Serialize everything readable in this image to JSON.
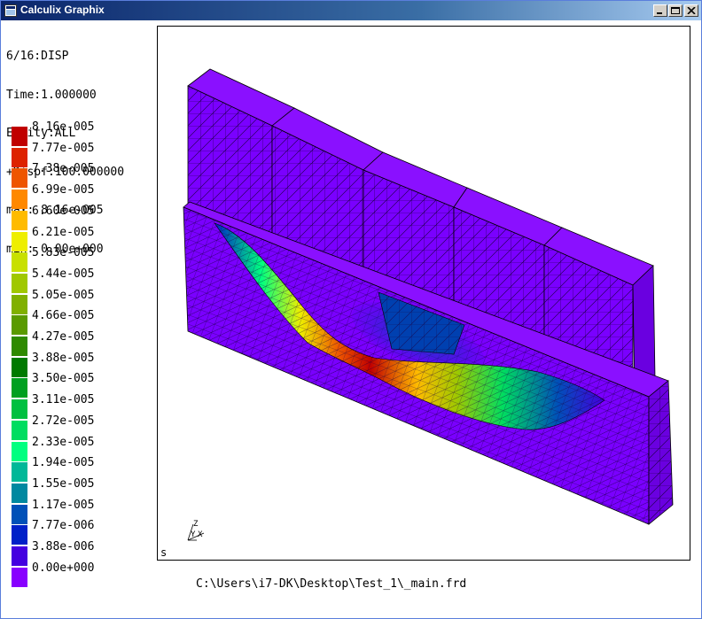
{
  "window": {
    "title": "Calculix Graphix"
  },
  "info": {
    "lines": [
      "6/16:DISP",
      "Time:1.000000",
      "Entity:ALL",
      "+Dispf:100.000000",
      "max: 8.16e-005",
      "min: 0.00e+000"
    ]
  },
  "legend": {
    "entries": [
      {
        "label": "8.16e-005",
        "color": "#c00000"
      },
      {
        "label": "7.77e-005",
        "color": "#dd2200"
      },
      {
        "label": "7.38e-005",
        "color": "#ee5500"
      },
      {
        "label": "6.99e-005",
        "color": "#ff8800"
      },
      {
        "label": "6.60e-005",
        "color": "#ffbb00"
      },
      {
        "label": "6.21e-005",
        "color": "#eeee00"
      },
      {
        "label": "5.83e-005",
        "color": "#c8e000"
      },
      {
        "label": "5.44e-005",
        "color": "#a0c800"
      },
      {
        "label": "5.05e-005",
        "color": "#80b000"
      },
      {
        "label": "4.66e-005",
        "color": "#5a9a00"
      },
      {
        "label": "4.27e-005",
        "color": "#2e8a00"
      },
      {
        "label": "3.88e-005",
        "color": "#007a00"
      },
      {
        "label": "3.50e-005",
        "color": "#00a020"
      },
      {
        "label": "3.11e-005",
        "color": "#00c040"
      },
      {
        "label": "2.72e-005",
        "color": "#00dd60"
      },
      {
        "label": "2.33e-005",
        "color": "#00ff80"
      },
      {
        "label": "1.94e-005",
        "color": "#00b898"
      },
      {
        "label": "1.55e-005",
        "color": "#0088a0"
      },
      {
        "label": "1.17e-005",
        "color": "#0050b8"
      },
      {
        "label": "7.77e-006",
        "color": "#0020c8"
      },
      {
        "label": "3.88e-006",
        "color": "#4400e0"
      },
      {
        "label": "0.00e+000",
        "color": "#8800ff"
      }
    ]
  },
  "viewport": {
    "corner_label": "s",
    "axes": {
      "z": "Z",
      "y": "Y",
      "x": "X"
    },
    "mesh_color": "#7a00ff"
  },
  "status": {
    "file_path": "C:\\Users\\i7-DK\\Desktop\\Test_1\\_main.frd"
  },
  "icons": {
    "app": "app-icon",
    "minimize": "minimize-icon",
    "maximize": "maximize-icon",
    "close": "close-icon"
  }
}
